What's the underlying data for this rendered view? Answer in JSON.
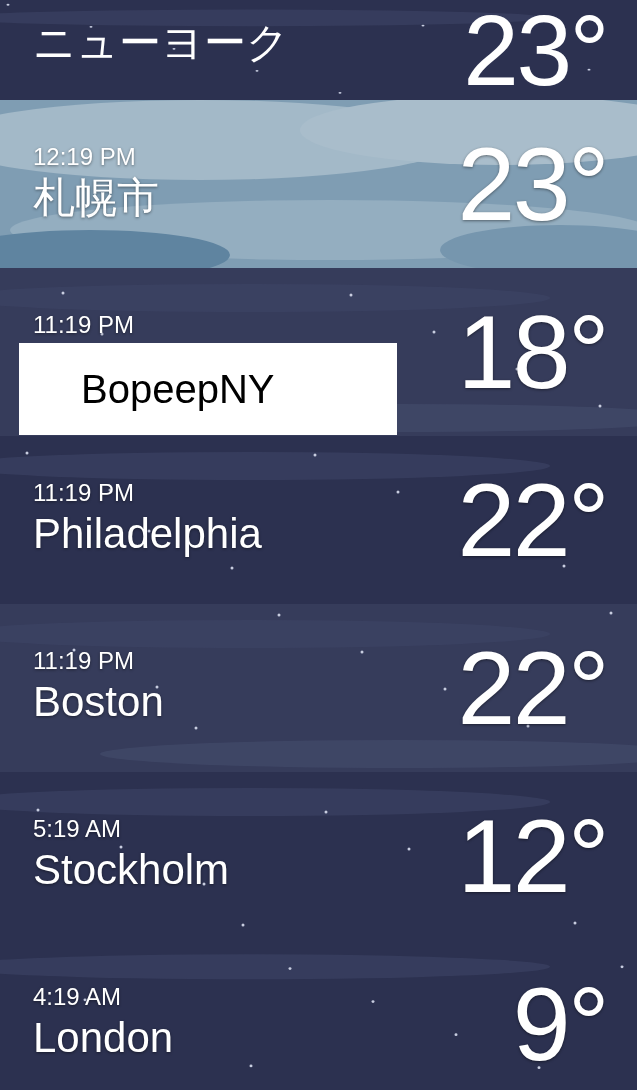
{
  "cities": [
    {
      "name": "ニューヨーク",
      "temp": "23°"
    },
    {
      "time": "12:19 PM",
      "name": "札幌市",
      "temp": "23°"
    },
    {
      "time": "11:19 PM",
      "temp": "18°"
    },
    {
      "time": "11:19 PM",
      "name": "Philadelphia",
      "temp": "22°"
    },
    {
      "time": "11:19 PM",
      "name": "Boston",
      "temp": "22°"
    },
    {
      "time": "5:19 AM",
      "name": "Stockholm",
      "temp": "12°"
    },
    {
      "time": "4:19 AM",
      "name": "London",
      "temp": "9°"
    }
  ],
  "overlay_label": "BopeepNY"
}
